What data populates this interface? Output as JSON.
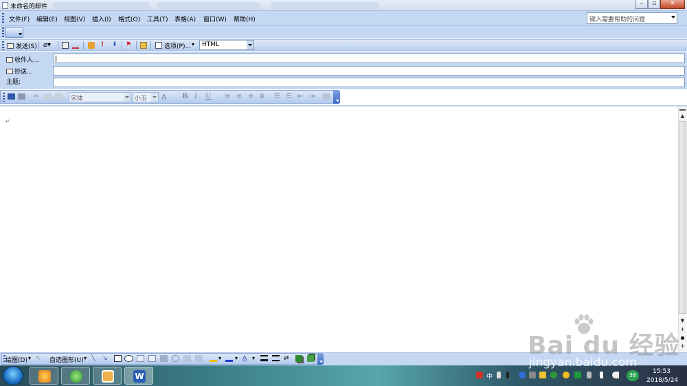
{
  "window": {
    "title": "未命名的邮件",
    "controls": {
      "minimize": "–",
      "restore": "▫",
      "close": "✕"
    }
  },
  "menu": {
    "items": [
      "文件(F)",
      "编辑(E)",
      "视图(V)",
      "插入(I)",
      "格式(O)",
      "工具(T)",
      "表格(A)",
      "窗口(W)",
      "帮助(H)"
    ],
    "help_placeholder": "键入需要帮助的问题"
  },
  "email_toolbar": {
    "send_label": "发送(S)",
    "options_label": "选项(P)...",
    "format_value": "HTML"
  },
  "header_fields": {
    "to_label": "收件人...",
    "cc_label": "抄送...",
    "subject_label": "主题:",
    "to_value": "",
    "cc_value": "",
    "subject_value": ""
  },
  "format_toolbar": {
    "font": "宋体",
    "size": "小五",
    "bold": "B",
    "italic": "I",
    "underline": "U",
    "font_color": "A"
  },
  "editor": {
    "paragraph_mark": "↵"
  },
  "drawing_toolbar": {
    "draw_label": "绘图(D)",
    "autoshapes_label": "自选图形(U)"
  },
  "taskbar": {
    "tray_text": "中",
    "badge": "38",
    "time": "15:53",
    "date": "2018/5/24"
  },
  "watermark": {
    "logo": "Bai du 经验",
    "url": "jingyan.baidu.com"
  },
  "colors": {
    "chrome": "#c4d7f3",
    "toolbar_accent": "#3b68c6",
    "titlebar": "#d3deee"
  }
}
